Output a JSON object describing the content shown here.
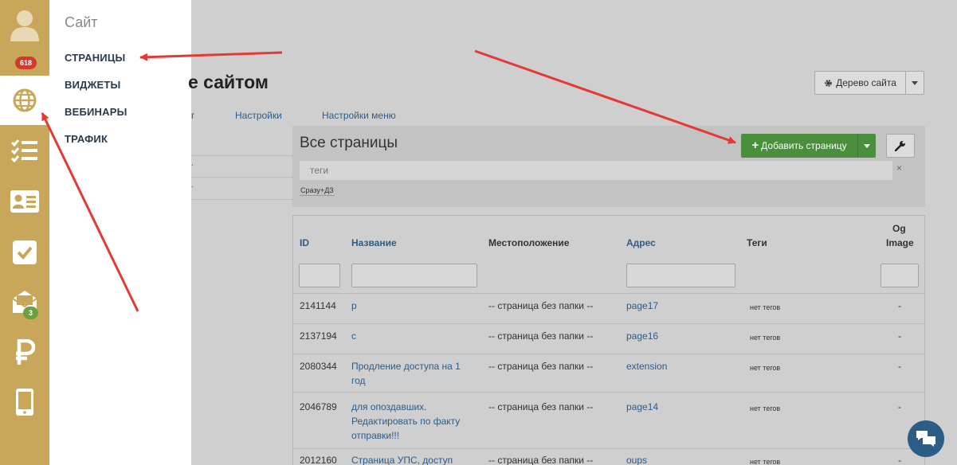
{
  "rail": {
    "profile_badge": "618",
    "mail_badge": "3"
  },
  "flyout": {
    "title": "Сайт",
    "items": [
      "СТРАНИЦЫ",
      "ВИДЖЕТЫ",
      "ВЕБИНАРЫ",
      "ТРАФИК"
    ]
  },
  "header": {
    "title": "е сайтом",
    "tree_button": "Дерево сайта"
  },
  "tabs": [
    "г",
    "Настройки",
    "Настройки меню"
  ],
  "left_list": [
    ".",
    "."
  ],
  "panel": {
    "title": "Все страницы",
    "add_button": "Добавить страницу",
    "tags_placeholder": "теги",
    "clear": "×",
    "tag_chip": "Сразу+ДЗ"
  },
  "table": {
    "headers": {
      "id": "ID",
      "name": "Название",
      "location": "Местоположение",
      "address": "Адрес",
      "tags": "Теги",
      "og_line1": "Og",
      "og_line2": "Image"
    },
    "rows": [
      {
        "id": "2141144",
        "name": [
          "р"
        ],
        "location": "-- страница без папки --",
        "address": "page17",
        "tags": "нет тегов",
        "og": "-"
      },
      {
        "id": "2137194",
        "name": [
          "с"
        ],
        "location": "-- страница без папки --",
        "address": "page16",
        "tags": "нет тегов",
        "og": "-"
      },
      {
        "id": "2080344",
        "name": [
          "Продление доступа на 1",
          "год"
        ],
        "location": "-- страница без папки --",
        "address": "extension",
        "tags": "нет тегов",
        "og": "-"
      },
      {
        "id": "2046789",
        "name": [
          "для опоздавших.",
          "Редактировать по факту",
          "отправки!!!"
        ],
        "location": "-- страница без папки --",
        "address": "page14",
        "tags": "нет тегов",
        "og": "-"
      },
      {
        "id": "2012160",
        "name": [
          "Страница УПС, доступ"
        ],
        "location": "-- страница без папки --",
        "address": "oups",
        "tags": "нет тегов",
        "og": "-"
      }
    ]
  },
  "colors": {
    "rail": "#c8a65a",
    "arrow": "#e53935",
    "add_button": "#4a8f3c",
    "link": "#2d5c88",
    "chat": "#2c5d86"
  }
}
